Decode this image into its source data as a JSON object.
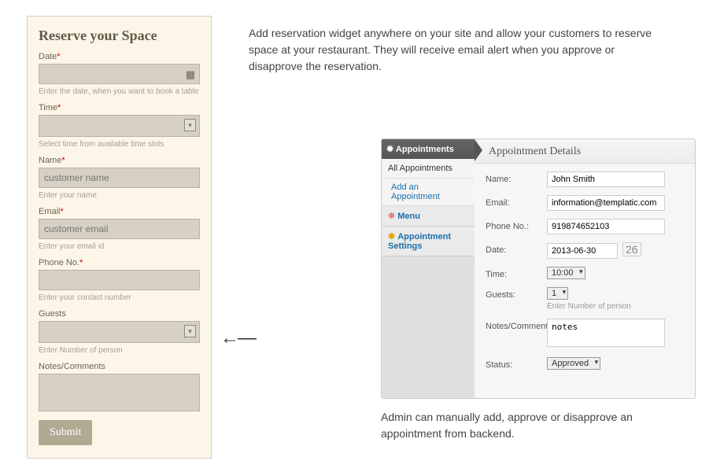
{
  "reserve": {
    "title": "Reserve your Space",
    "date": {
      "label": "Date",
      "placeholder": "",
      "hint": "Enter the date, when you want to book a table"
    },
    "time": {
      "label": "Time",
      "hint": "Select time from available time slots"
    },
    "name": {
      "label": "Name",
      "placeholder": "customer name",
      "hint": "Enter your name"
    },
    "email": {
      "label": "Email",
      "placeholder": "customer email",
      "hint": "Enter your email id"
    },
    "phone": {
      "label": "Phone No.",
      "placeholder": "",
      "hint": "Enter your contact number"
    },
    "guests": {
      "label": "Guests",
      "hint": "Enter Number of person"
    },
    "notes": {
      "label": "Notes/Comments"
    },
    "submit": "Submit"
  },
  "desc_top": "Add reservation widget anywhere on your site and allow your customers to reserve space at your restaurant. They will receive email alert when you approve or disapprove the reservation.",
  "desc_bottom": "Admin can manually add, approve or disapprove an appointment from backend.",
  "admin": {
    "sidebar": {
      "appointments": "Appointments",
      "all": "All Appointments",
      "add": "Add an Appointment",
      "menu": "Menu",
      "settings": "Appointment Settings"
    },
    "title": "Appointment Details",
    "rows": {
      "name": {
        "label": "Name:",
        "value": "John Smith"
      },
      "email": {
        "label": "Email:",
        "value": "information@templatic.com"
      },
      "phone": {
        "label": "Phone No.:",
        "value": "919874652103"
      },
      "date": {
        "label": "Date:",
        "value": "2013-06-30",
        "daynum": "26"
      },
      "time": {
        "label": "Time:",
        "value": "10:00"
      },
      "guests": {
        "label": "Guests:",
        "value": "1",
        "hint": "Enter Number of person"
      },
      "notes": {
        "label": "Notes/Comments:",
        "value": "notes"
      },
      "status": {
        "label": "Status:",
        "value": "Approved"
      }
    }
  }
}
